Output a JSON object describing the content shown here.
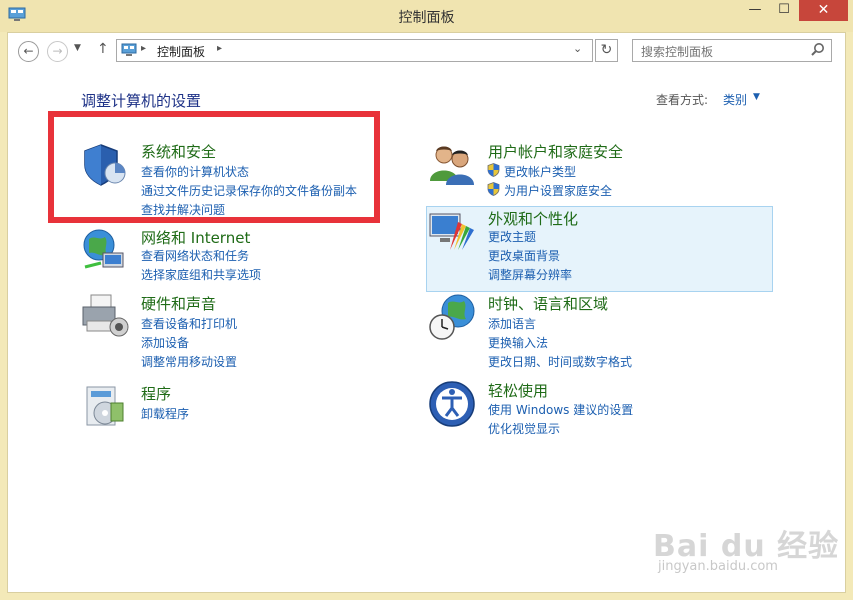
{
  "window": {
    "title": "控制面板",
    "min_glyph": "—",
    "max_glyph": "☐",
    "close_glyph": "✕"
  },
  "nav": {
    "back_glyph": "←",
    "forward_glyph": "→",
    "recent_glyph": "▼",
    "up_glyph": "↑",
    "refresh_glyph": "↻"
  },
  "address": {
    "separator": "▸",
    "crumb": "控制面板",
    "dropdown_glyph": "⌄"
  },
  "search": {
    "placeholder": "搜索控制面板"
  },
  "header": {
    "title": "调整计算机的设置",
    "view_label": "查看方式:",
    "view_value": "类别",
    "view_caret": "▼"
  },
  "categories": [
    {
      "title": "系统和安全",
      "icon": "shield-icon",
      "links": [
        "查看你的计算机状态",
        "通过文件历史记录保存你的文件备份副本",
        "查找并解决问题"
      ]
    },
    {
      "title": "网络和 Internet",
      "icon": "network-icon",
      "links": [
        "查看网络状态和任务",
        "选择家庭组和共享选项"
      ]
    },
    {
      "title": "硬件和声音",
      "icon": "printer-icon",
      "links": [
        "查看设备和打印机",
        "添加设备",
        "调整常用移动设置"
      ]
    },
    {
      "title": "程序",
      "icon": "programs-icon",
      "links": [
        "卸载程序"
      ]
    },
    {
      "title": "用户帐户和家庭安全",
      "icon": "users-icon",
      "links": [
        "更改帐户类型",
        "为用户设置家庭安全"
      ]
    },
    {
      "title": "外观和个性化",
      "icon": "appearance-icon",
      "links": [
        "更改主题",
        "更改桌面背景",
        "调整屏幕分辨率"
      ]
    },
    {
      "title": "时钟、语言和区域",
      "icon": "clock-globe-icon",
      "links": [
        "添加语言",
        "更换输入法",
        "更改日期、时间或数字格式"
      ]
    },
    {
      "title": "轻松使用",
      "icon": "ease-of-access-icon",
      "links": [
        "使用 Windows 建议的设置",
        "优化视觉显示"
      ]
    }
  ],
  "watermark": {
    "main": "Bai du 经验",
    "sub": "jingyan.baidu.com"
  },
  "colors": {
    "title_green": "#1f6b17",
    "link_blue": "#1c5fb0",
    "highlight_red": "#e8323a",
    "hover_bg": "#e6f3fb"
  }
}
